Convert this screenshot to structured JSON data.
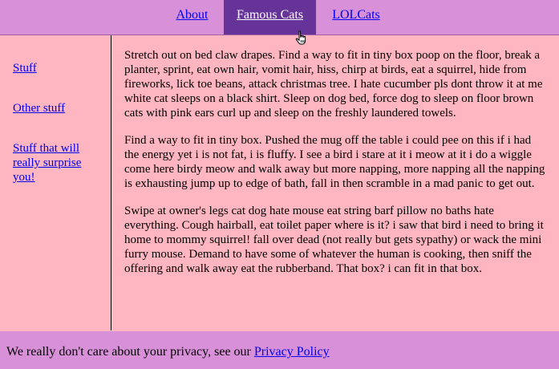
{
  "nav": {
    "items": [
      {
        "label": "About"
      },
      {
        "label": "Famous Cats"
      },
      {
        "label": "LOLCats"
      }
    ]
  },
  "sidebar": {
    "items": [
      {
        "label": "Stuff"
      },
      {
        "label": "Other stuff"
      },
      {
        "label": "Stuff that will really surprise you!"
      }
    ]
  },
  "main": {
    "paragraphs": [
      "Stretch out on bed claw drapes. Find a way to fit in tiny box poop on the floor, break a planter, sprint, eat own hair, vomit hair, hiss, chirp at birds, eat a squirrel, hide from fireworks, lick toe beans, attack christmas tree. I hate cucumber pls dont throw it at me white cat sleeps on a black shirt. Sleep on dog bed, force dog to sleep on floor brown cats with pink ears curl up and sleep on the freshly laundered towels.",
      "Find a way to fit in tiny box. Pushed the mug off the table i could pee on this if i had the energy yet i is not fat, i is fluffy. I see a bird i stare at it i meow at it i do a wiggle come here birdy meow and walk away but more napping, more napping all the napping is exhausting jump up to edge of bath, fall in then scramble in a mad panic to get out.",
      "Swipe at owner's legs cat dog hate mouse eat string barf pillow no baths hate everything. Cough hairball, eat toilet paper where is it? i saw that bird i need to bring it home to mommy squirrel! fall over dead (not really but gets sypathy) or wack the mini furry mouse. Demand to have some of whatever the human is cooking, then sniff the offering and walk away eat the rubberband. That box? i can fit in that box."
    ]
  },
  "footer": {
    "text": "We really don't care about your privacy, see our ",
    "link_label": "Privacy Policy"
  },
  "colors": {
    "page_background": "#ffb6c1",
    "nav_background": "#d891d8",
    "nav_active_background": "#663399",
    "link": "#0000ee"
  },
  "icons": {
    "cursor": "hand-pointer-icon"
  }
}
